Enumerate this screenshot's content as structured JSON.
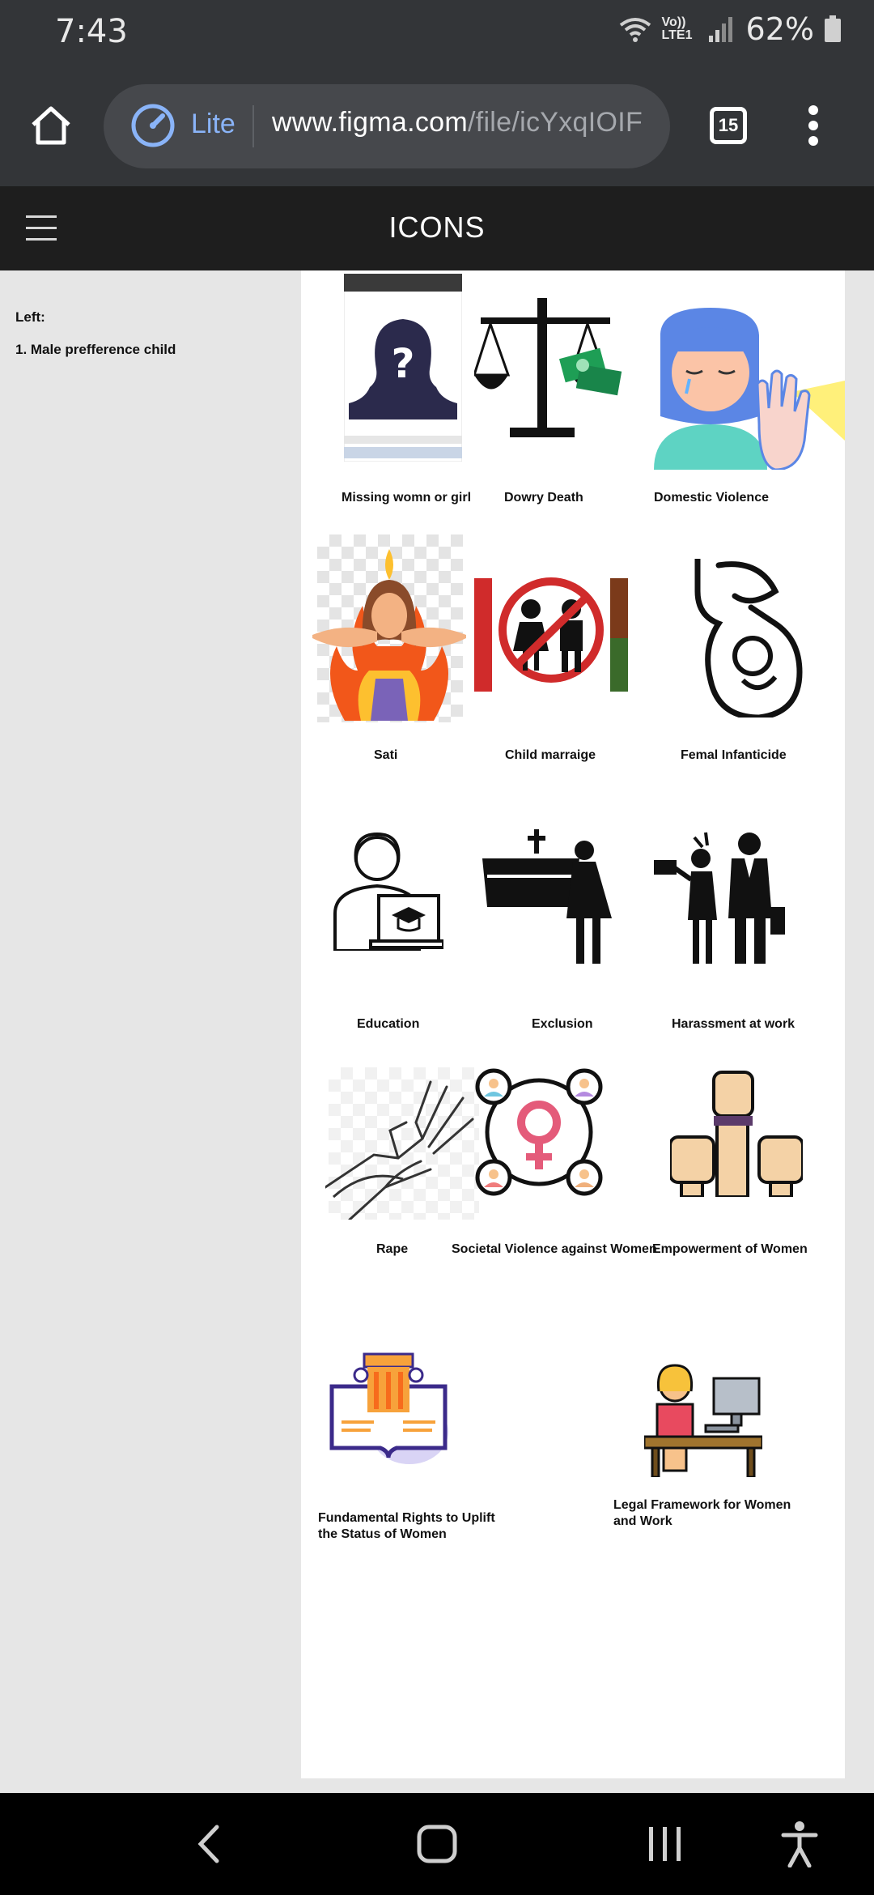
{
  "status_bar": {
    "time": "7:43",
    "network_label": "Vo)) LTE1",
    "battery": "62%"
  },
  "browser": {
    "lite_label": "Lite",
    "url_host": "www.figma.com",
    "url_path": "/file/icYxqIOIF",
    "tab_count": "15"
  },
  "app": {
    "title": "ICONS"
  },
  "left_panel": {
    "heading": "Left:",
    "items": [
      "1. Male prefference child"
    ]
  },
  "icons": [
    {
      "label": "Missing womn or girl"
    },
    {
      "label": "Dowry Death"
    },
    {
      "label": "Domestic Violence"
    },
    {
      "label": "Sati"
    },
    {
      "label": "Child marraige"
    },
    {
      "label": "Femal Infanticide"
    },
    {
      "label": "Education"
    },
    {
      "label": "Exclusion"
    },
    {
      "label": "Harassment at work"
    },
    {
      "label": "Rape"
    },
    {
      "label": "Societal Violence against Women"
    },
    {
      "label": "Empowerment of Women"
    },
    {
      "label_line1": "Fundamental Rights to Uplift",
      "label_line2": "the Status of Women"
    },
    {
      "label_line1": "Legal Framework for Women",
      "label_line2": "and Work"
    }
  ],
  "colors": {
    "status_bg": "#333538",
    "appbar_bg": "#1e1e1e",
    "canvas_bg": "#e6e6e6",
    "frame_bg": "#ffffff",
    "accent_blue": "#8ab4f8"
  }
}
